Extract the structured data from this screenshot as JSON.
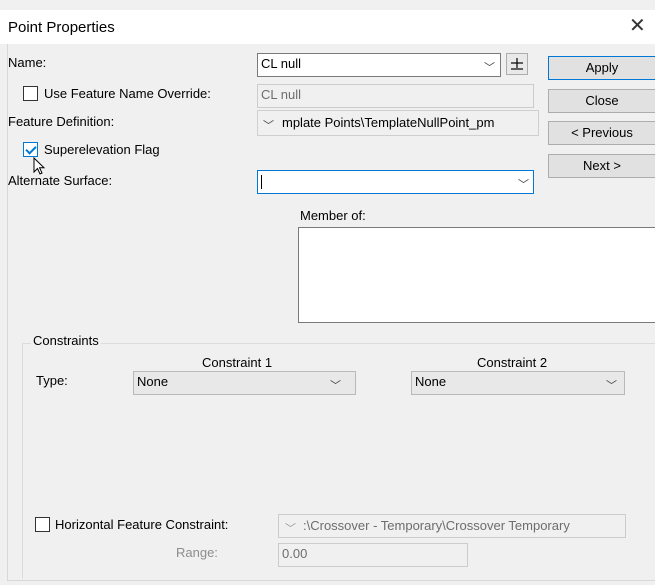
{
  "window": {
    "title": "Point Properties"
  },
  "name": {
    "label": "Name:",
    "value": "CL null"
  },
  "use_override": {
    "label": "Use Feature Name Override:",
    "value": "CL null",
    "checked": false
  },
  "feature_definition": {
    "label": "Feature Definition:",
    "value": "mplate Points\\TemplateNullPoint_pm"
  },
  "superelevation": {
    "label": "Superelevation Flag",
    "checked": true
  },
  "alternate_surface": {
    "label": "Alternate Surface:",
    "value": ""
  },
  "member_of": {
    "label": "Member of:"
  },
  "buttons": {
    "apply": "Apply",
    "close": "Close",
    "previous": "< Previous",
    "next": "Next >"
  },
  "constraints": {
    "group_label": "Constraints",
    "c1_header": "Constraint 1",
    "c2_header": "Constraint 2",
    "type_label": "Type:",
    "c1_value": "None",
    "c2_value": "None"
  },
  "horizontal": {
    "label": "Horizontal Feature Constraint:",
    "checked": false,
    "value": ":\\Crossover - Temporary\\Crossover Temporary",
    "range_label": "Range:",
    "range_value": "0.00"
  },
  "icons": [
    "close-icon",
    "chevron-down-icon",
    "pick-point-icon",
    "checkbox-icon",
    "mouse-cursor-icon"
  ]
}
